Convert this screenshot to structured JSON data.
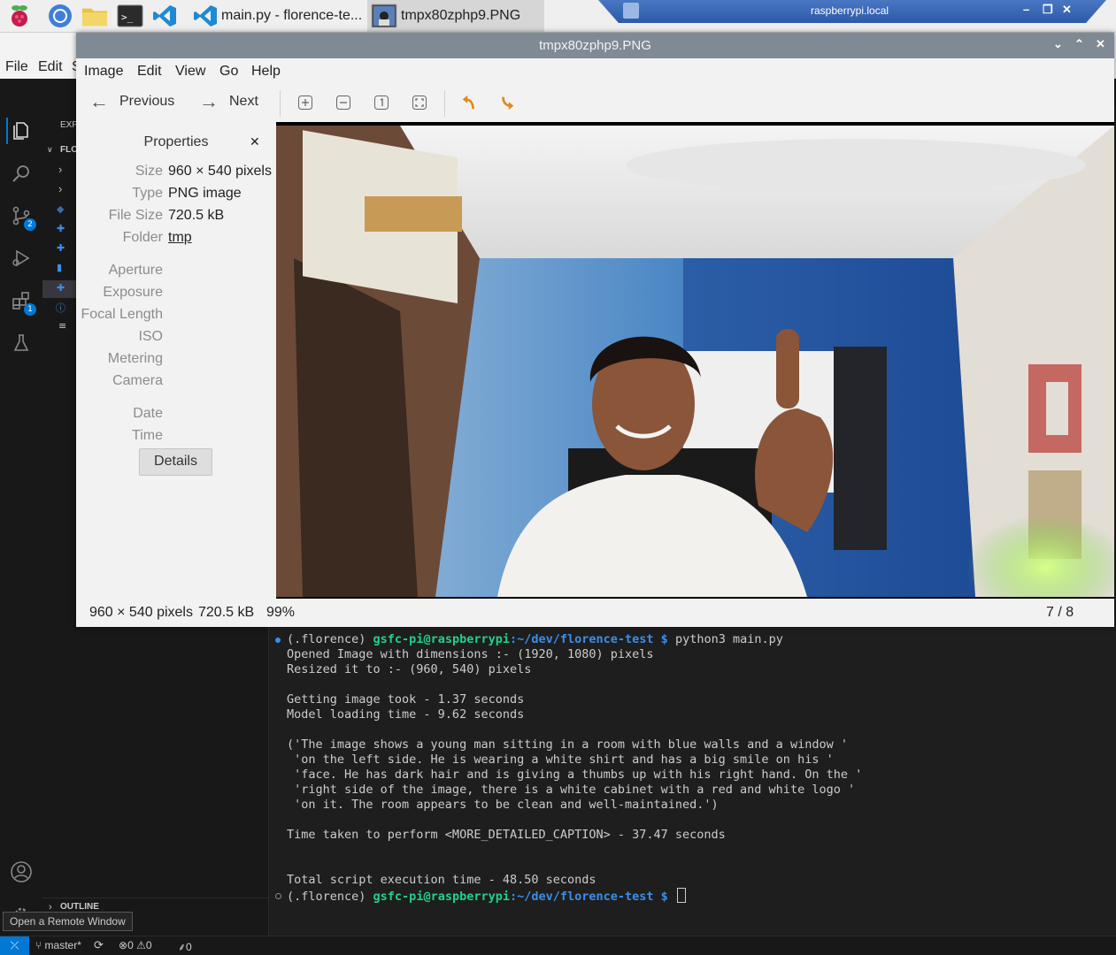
{
  "taskbar": {
    "launchers": [
      "raspberry-pi-menu",
      "chromium",
      "file-manager",
      "terminal",
      "vscode"
    ],
    "tasks": [
      {
        "label": "main.py - florence-te...",
        "active": false
      },
      {
        "label": "tmpx80zphp9.PNG",
        "active": true
      }
    ],
    "remote_host": "raspberrypi.local"
  },
  "vscode": {
    "menu": [
      "File",
      "Edit",
      "S"
    ],
    "explorer_header": "EXP",
    "folder_label": "FLO",
    "outline_label": "OUTLINE",
    "remote_tooltip": "Open a Remote Window",
    "source_control_badge": "2",
    "extensions_badge": "1",
    "status": {
      "branch": "master*",
      "errors": "0",
      "warnings": "0",
      "ports": "0"
    }
  },
  "terminal": {
    "prompt_env": "(.florence) ",
    "prompt_user_host": "gsfc-pi@raspberrypi",
    "prompt_path": ":~/dev/florence-test",
    "prompt_symbol": " $ ",
    "command": "python3 main.py",
    "output": [
      "Opened Image with dimensions :- (1920, 1080) pixels",
      "Resized it to :- (960, 540) pixels",
      "",
      "Getting image took - 1.37 seconds",
      "Model loading time - 9.62 seconds",
      "",
      "('The image shows a young man sitting in a room with blue walls and a window '",
      " 'on the left side. He is wearing a white shirt and has a big smile on his '",
      " 'face. He has dark hair and is giving a thumbs up with his right hand. On the '",
      " 'right side of the image, there is a white cabinet with a red and white logo '",
      " 'on it. The room appears to be clean and well-maintained.')",
      "",
      "Time taken to perform <MORE_DETAILED_CAPTION> - 37.47 seconds",
      "",
      "",
      "Total script execution time - 48.50 seconds"
    ]
  },
  "viewer": {
    "title": "tmpx80zphp9.PNG",
    "menu": [
      "Image",
      "Edit",
      "View",
      "Go",
      "Help"
    ],
    "prev_label": "Previous",
    "next_label": "Next",
    "properties": {
      "header": "Properties",
      "rows": [
        {
          "label": "Size",
          "value": "960 × 540 pixels"
        },
        {
          "label": "Type",
          "value": "PNG image"
        },
        {
          "label": "File Size",
          "value": "720.5 kB"
        },
        {
          "label": "Folder",
          "value": "tmp"
        },
        {
          "label": "Aperture",
          "value": ""
        },
        {
          "label": "Exposure",
          "value": ""
        },
        {
          "label": "Focal Length",
          "value": ""
        },
        {
          "label": "ISO",
          "value": ""
        },
        {
          "label": "Metering",
          "value": ""
        },
        {
          "label": "Camera",
          "value": ""
        },
        {
          "label": "Date",
          "value": ""
        },
        {
          "label": "Time",
          "value": ""
        }
      ],
      "details_button": "Details"
    },
    "status": {
      "dimensions": "960 × 540 pixels",
      "file_size": "720.5 kB",
      "zoom": "99%",
      "position": "7 / 8"
    }
  }
}
